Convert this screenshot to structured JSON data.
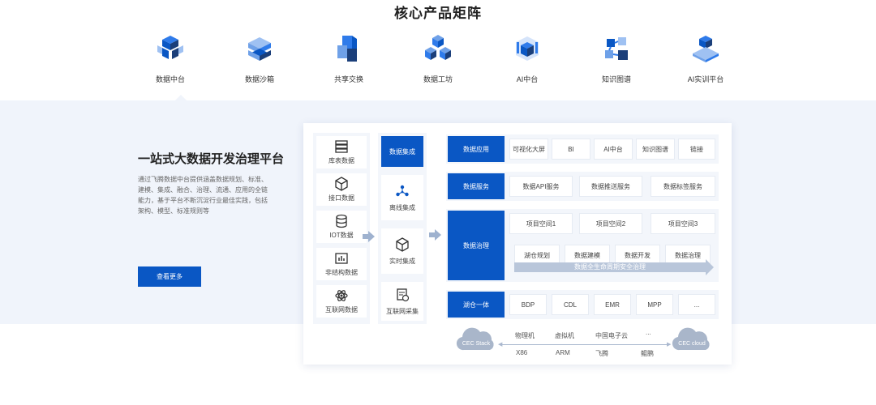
{
  "section_title": "核心产品矩阵",
  "products": [
    {
      "name": "数据中台",
      "icon": "data-middle-platform-icon"
    },
    {
      "name": "数据沙箱",
      "icon": "data-sandbox-icon"
    },
    {
      "name": "共享交换",
      "icon": "share-exchange-icon"
    },
    {
      "name": "数据工坊",
      "icon": "data-workshop-icon"
    },
    {
      "name": "AI中台",
      "icon": "ai-platform-icon"
    },
    {
      "name": "知识图谱",
      "icon": "knowledge-graph-icon"
    },
    {
      "name": "AI实训平台",
      "icon": "ai-training-icon"
    }
  ],
  "intro": {
    "title": "一站式大数据开发治理平台",
    "description": "通过飞腾数据中台提供涵盖数据规划、标准、建模、集成、融合、治理、流通、应用的全链能力，基于平台不断沉淀行业最佳实践，包括架构、模型、标准规则等",
    "button": "查看更多"
  },
  "sources": [
    "库表数据",
    "接口数据",
    "IOT数据",
    "非结构数据",
    "互联网数据"
  ],
  "integration": {
    "header": "数据集成",
    "items": [
      "离线集成",
      "实时集成",
      "互联网采集"
    ]
  },
  "layers": {
    "app": {
      "head": "数据应用",
      "cells": [
        "可视化大屏",
        "BI",
        "AI中台",
        "知识图谱",
        "链接"
      ]
    },
    "service": {
      "head": "数据服务",
      "cells": [
        "数据API服务",
        "数据推送服务",
        "数据标签服务"
      ]
    },
    "governance": {
      "head": "数据治理",
      "workspaces": [
        "项目空间1",
        "项目空间2",
        "项目空间3"
      ],
      "tools": [
        "湖仓规划",
        "数据建模",
        "数据开发",
        "数据治理"
      ],
      "band": "数据全生命周期安全治理"
    },
    "lakehouse": {
      "head": "湖仓一体",
      "cells": [
        "BDP",
        "CDL",
        "EMR",
        "MPP",
        "..."
      ]
    }
  },
  "infra": {
    "left_cloud": "CEC Stack",
    "right_cloud": "CEC cloud",
    "top": [
      "物理机",
      "虚拟机",
      "中国电子云",
      "..."
    ],
    "bottom": [
      "X86",
      "ARM",
      "飞腾",
      "鲲鹏"
    ]
  },
  "colors": {
    "primary": "#0a57c4",
    "band": "#f0f4fb",
    "panel_bg": "#f3f6fb"
  }
}
